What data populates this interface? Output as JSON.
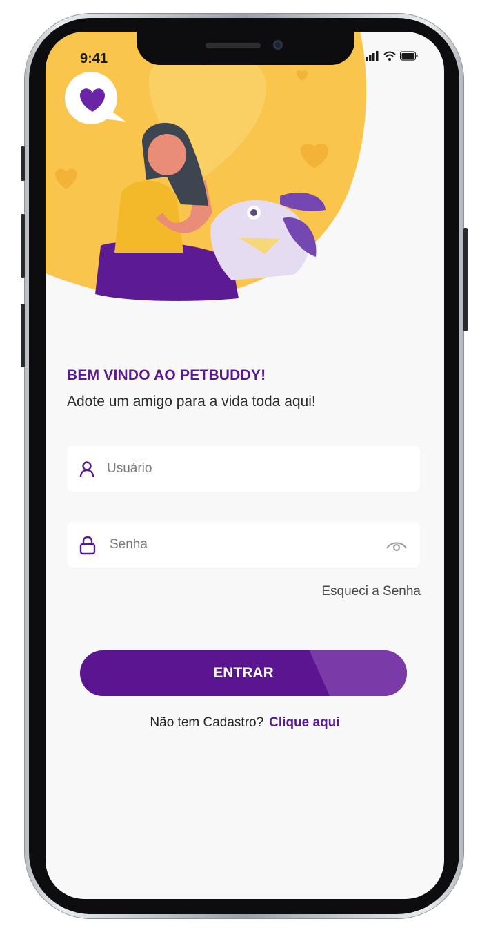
{
  "status_bar": {
    "time": "9:41"
  },
  "login": {
    "welcome_title": "BEM VINDO AO PETBUDDY!",
    "subtitle": "Adote um amigo para a vida toda aqui!",
    "username_placeholder": "Usuário",
    "password_placeholder": "Senha",
    "forgot_password": "Esqueci a Senha",
    "submit_label": "ENTRAR",
    "signup_prompt": "Não tem Cadastro?",
    "signup_link": "Clique aqui"
  },
  "colors": {
    "brand_purple": "#5b1891",
    "hero_yellow": "#f9c54c",
    "background": "#f8f8f8"
  },
  "icons": [
    "heart-icon",
    "user-icon",
    "lock-icon",
    "eye-icon",
    "signal-icon",
    "wifi-icon",
    "battery-icon"
  ]
}
